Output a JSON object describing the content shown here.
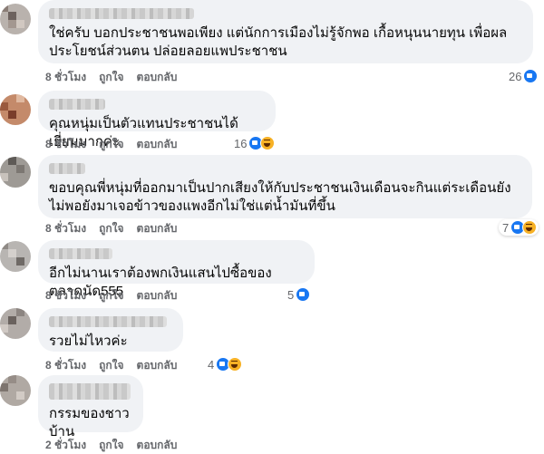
{
  "comments": [
    {
      "text": "ใช่ครับ บอกประชาชนพอเพียง แต่นักการเมืองไม่รู้จักพอ เกื้อหนุนนายทุน เพื่อผลประโยชน์ส่วนตน ปล่อยลอยแพประชาชน",
      "time": "8 ชั่วโมง",
      "like": "ถูกใจ",
      "reply": "ตอบกลับ",
      "reaction_count": "26",
      "reaction_icons": [
        "like-icon"
      ]
    },
    {
      "text": "คุณหนุ่มเป็นตัวแทนประชาชนได้เยี่ยมมากค่ะ",
      "time": "8 ชั่วโมง",
      "like": "ถูกใจ",
      "reply": "ตอบกลับ",
      "reaction_count": "16",
      "reaction_icons": [
        "like-icon",
        "haha-icon"
      ]
    },
    {
      "text": "ขอบคุณพี่หนุ่มที่ออกมาเป็นปากเสียงให้กับประชาชนเงินเดือนจะกินแต่ระเดือนยังไม่พอยังมาเจอข้าวของแพงอีกไม่ใช่แต่น้ำมันที่ขึ้น",
      "time": "8 ชั่วโมง",
      "like": "ถูกใจ",
      "reply": "ตอบกลับ",
      "reaction_count": "7",
      "reaction_icons": [
        "like-icon",
        "haha-icon"
      ]
    },
    {
      "text": "อีกไม่นานเราต้องพกเงินแสนไปซื้อของตลาดนัด555",
      "time": "8 ชั่วโมง",
      "like": "ถูกใจ",
      "reply": "ตอบกลับ",
      "reaction_count": "5",
      "reaction_icons": [
        "like-icon"
      ]
    },
    {
      "text": "รวยไม่ไหวค่ะ",
      "time": "8 ชั่วโมง",
      "like": "ถูกใจ",
      "reply": "ตอบกลับ",
      "reaction_count": "4",
      "reaction_icons": [
        "like-icon",
        "haha-icon"
      ]
    },
    {
      "text": "กรรมของชาวบ้าน",
      "time": "2 ชั่วโมง",
      "like": "ถูกใจ",
      "reply": "ตอบกลับ",
      "reaction_count": "",
      "reaction_icons": []
    }
  ],
  "colors": {
    "bubble": "#f0f2f5",
    "meta_text": "#65676b",
    "like_blue": "#1877f2",
    "haha_yellow": "#f7b125"
  }
}
